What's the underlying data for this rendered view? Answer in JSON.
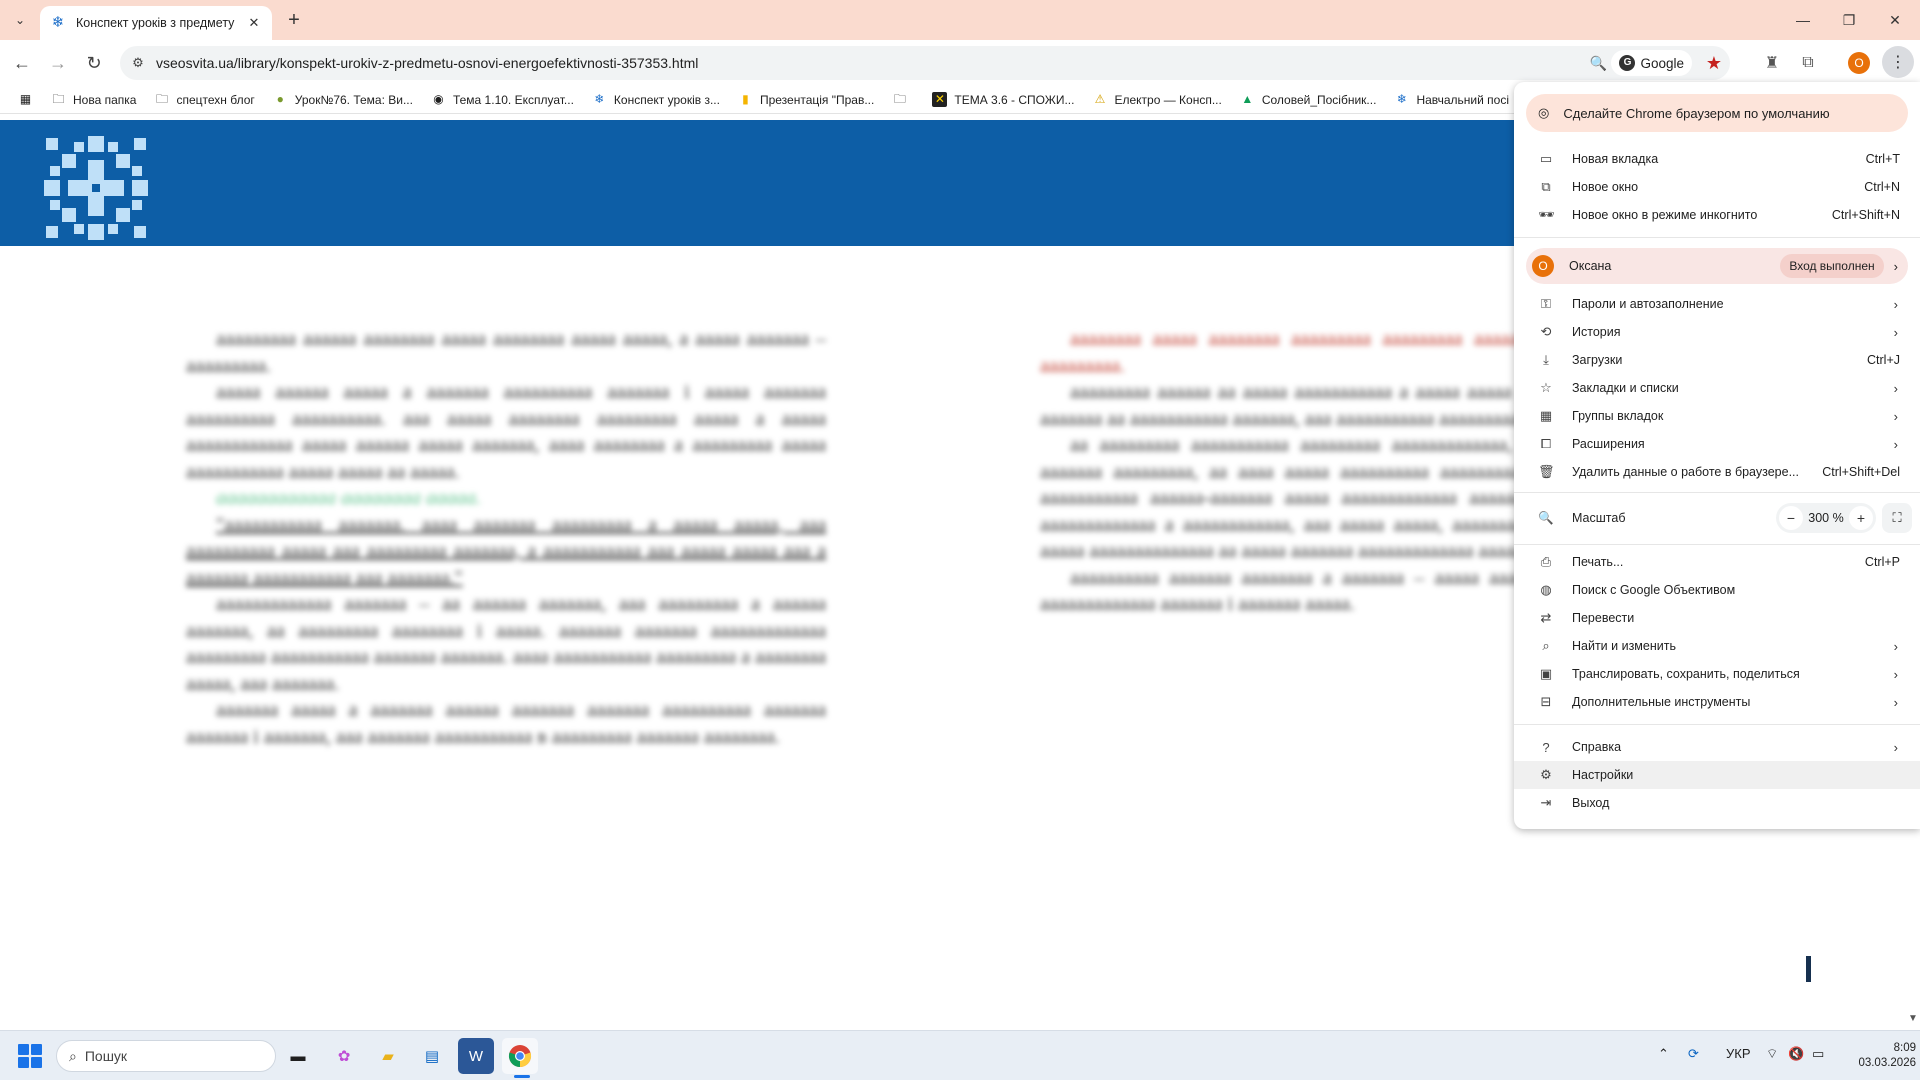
{
  "browser": {
    "tab_title": "Конспект уроків з предмету \"О",
    "url": "vseosvita.ua/library/konspekt-urokiv-z-predmetu-osnovi-energoefektivnosti-357353.html",
    "search_chip": "Google",
    "profile_initial": "О"
  },
  "bookmarks": [
    {
      "label": "Нова папка",
      "icon": "folder-icon"
    },
    {
      "label": "спецтехн блог",
      "icon": "folder-icon"
    },
    {
      "label": "Урок№76. Тема: Ви...",
      "icon": "site-icon"
    },
    {
      "label": "Тема 1.10. Експлуат...",
      "icon": "globe-icon"
    },
    {
      "label": "Конспект уроків з...",
      "icon": "snowflake-icon"
    },
    {
      "label": "Презентація \"Прав...",
      "icon": "slides-icon"
    },
    {
      "label": "",
      "icon": "folder-icon"
    },
    {
      "label": "ТЕМА 3.6 - СПОЖИ...",
      "icon": "site-icon"
    },
    {
      "label": "Електро — Консп...",
      "icon": "warning-icon"
    },
    {
      "label": "Соловей_Посібник...",
      "icon": "drive-icon"
    },
    {
      "label": "Навчальний посі",
      "icon": "snowflake-icon"
    }
  ],
  "menu": {
    "promo": "Сделайте Chrome браузером по умолчанию",
    "new_tab": "Новая вкладка",
    "new_tab_sc": "Ctrl+T",
    "new_window": "Новое окно",
    "new_window_sc": "Ctrl+N",
    "incognito": "Новое окно в режиме инкогнито",
    "incognito_sc": "Ctrl+Shift+N",
    "profile_name": "Оксана",
    "profile_status": "Вход выполнен",
    "passwords": "Пароли и автозаполнение",
    "history": "История",
    "downloads": "Загрузки",
    "downloads_sc": "Ctrl+J",
    "bookmarks": "Закладки и списки",
    "tab_groups": "Группы вкладок",
    "extensions": "Расширения",
    "clear_data": "Удалить данные о работе в браузере...",
    "clear_data_sc": "Ctrl+Shift+Del",
    "zoom_label": "Масштаб",
    "zoom_value": "300 %",
    "print": "Печать...",
    "print_sc": "Ctrl+P",
    "lens": "Поиск с Google Объективом",
    "translate": "Перевести",
    "find": "Найти и изменить",
    "cast": "Транслировать, сохранить, поделиться",
    "more_tools": "Дополнительные инструменты",
    "help": "Справка",
    "settings": "Настройки",
    "exit": "Выход"
  },
  "taskbar": {
    "search_placeholder": "Пошук",
    "language": "УКР",
    "time": "8:09",
    "date": "03.03.2026"
  },
  "colors": {
    "titlebar": "#fadbcf",
    "site_header": "#0d5ea6",
    "profile_orange": "#e8710a",
    "bookmark_star": "#c5221f"
  }
}
